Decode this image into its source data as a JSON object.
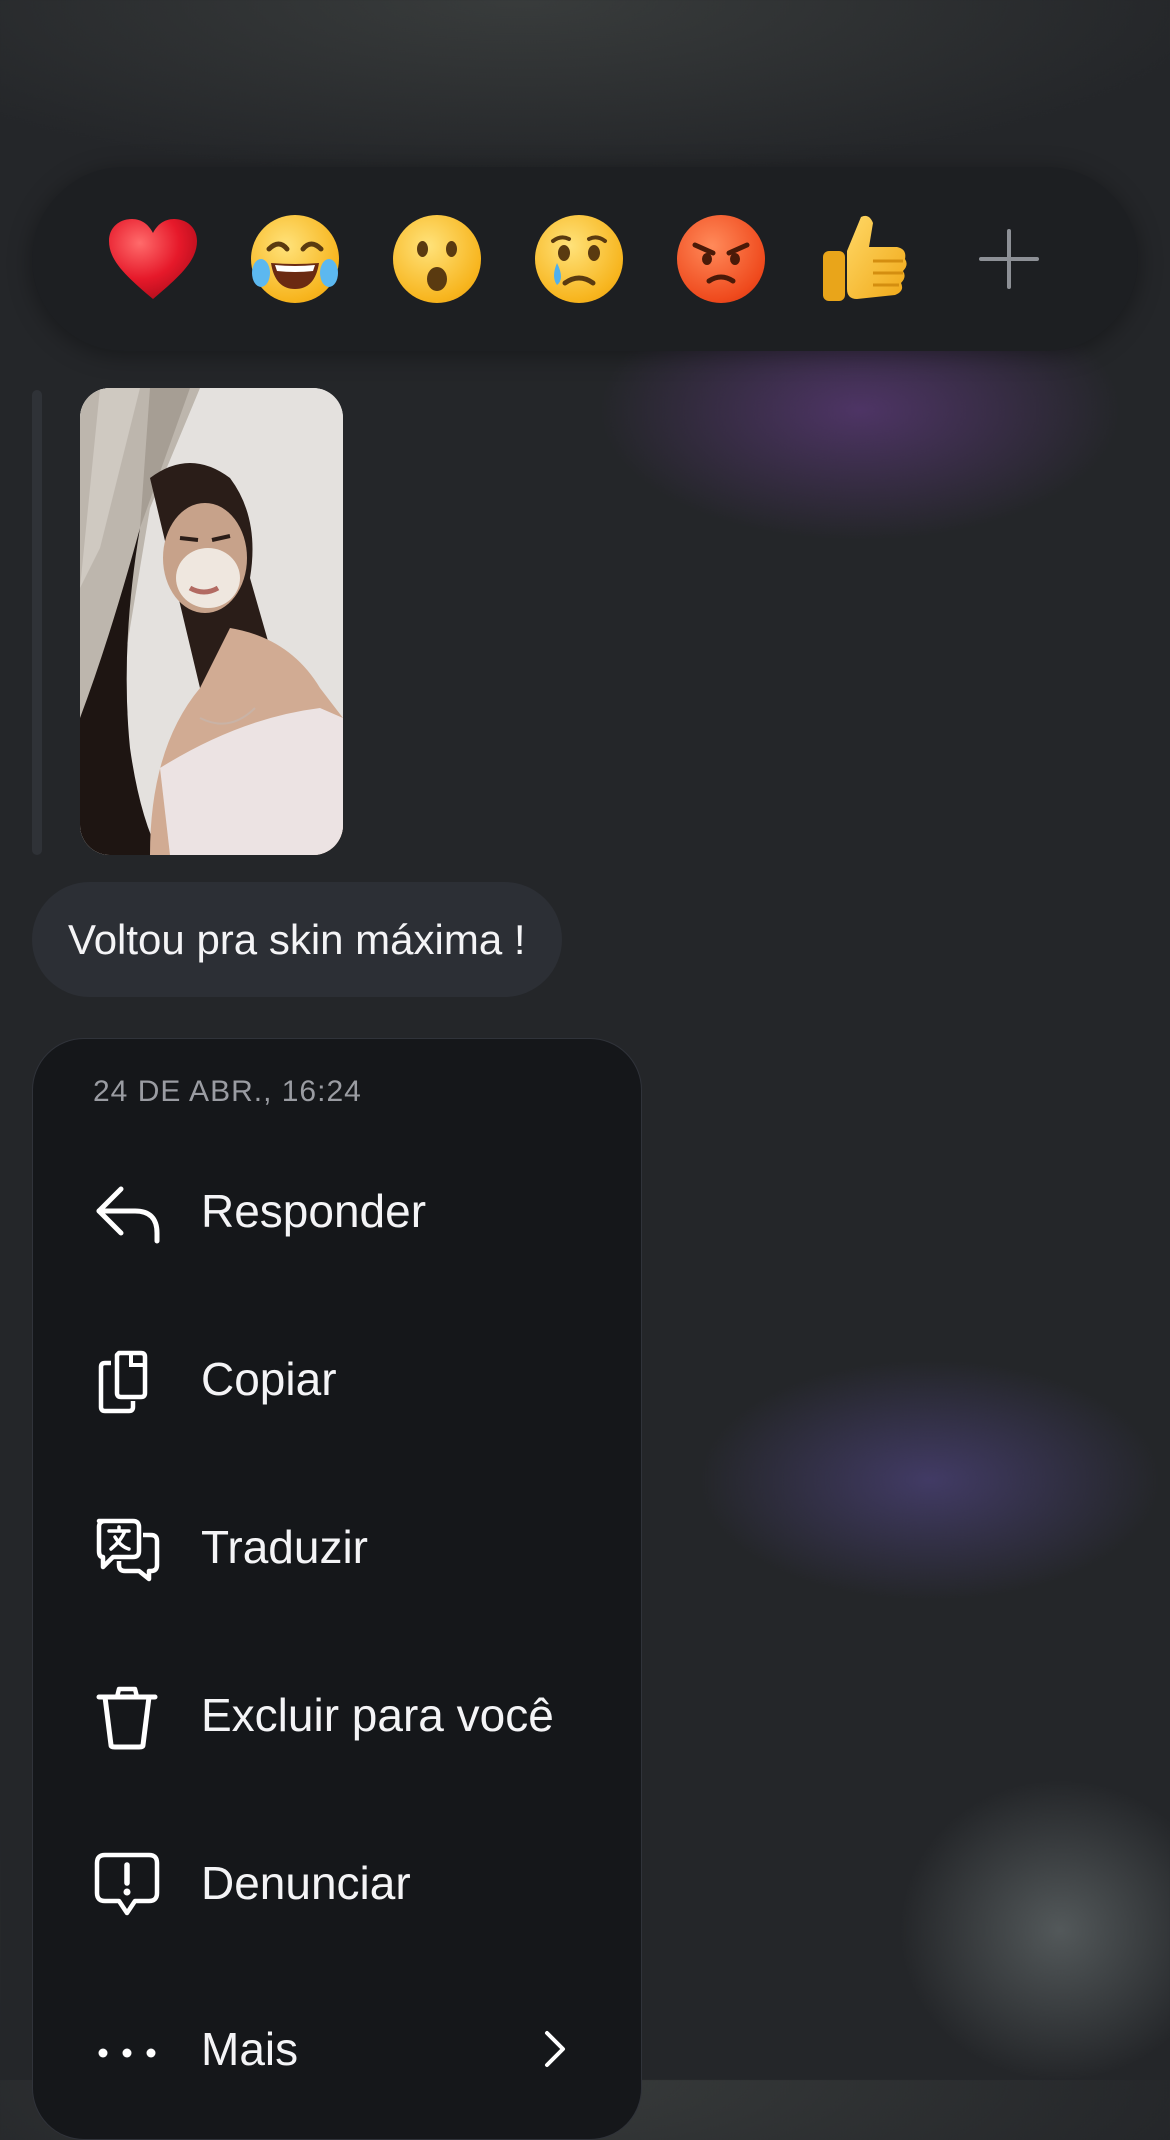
{
  "reactions": {
    "emojis": [
      {
        "name": "heart",
        "glyph": "❤"
      },
      {
        "name": "joy",
        "glyph": "😂"
      },
      {
        "name": "surprised",
        "glyph": "😮"
      },
      {
        "name": "crying",
        "glyph": "😢"
      },
      {
        "name": "angry",
        "glyph": "😡"
      },
      {
        "name": "thumbs-up",
        "glyph": "👍"
      }
    ],
    "add_icon": "plus-icon"
  },
  "message": {
    "text": "Voltou pra skin máxima !"
  },
  "context_menu": {
    "timestamp": "24 DE ABR., 16:24",
    "items": [
      {
        "label": "Responder",
        "icon": "reply-icon"
      },
      {
        "label": "Copiar",
        "icon": "copy-icon"
      },
      {
        "label": "Traduzir",
        "icon": "translate-icon"
      },
      {
        "label": "Excluir para você",
        "icon": "trash-icon"
      },
      {
        "label": "Denunciar",
        "icon": "report-icon"
      },
      {
        "label": "Mais",
        "icon": "more-icon"
      }
    ]
  },
  "colors": {
    "background": "#242629",
    "reaction_bar": "#1d1f22",
    "bubble": "#2c2f35",
    "menu": "#15171a"
  }
}
